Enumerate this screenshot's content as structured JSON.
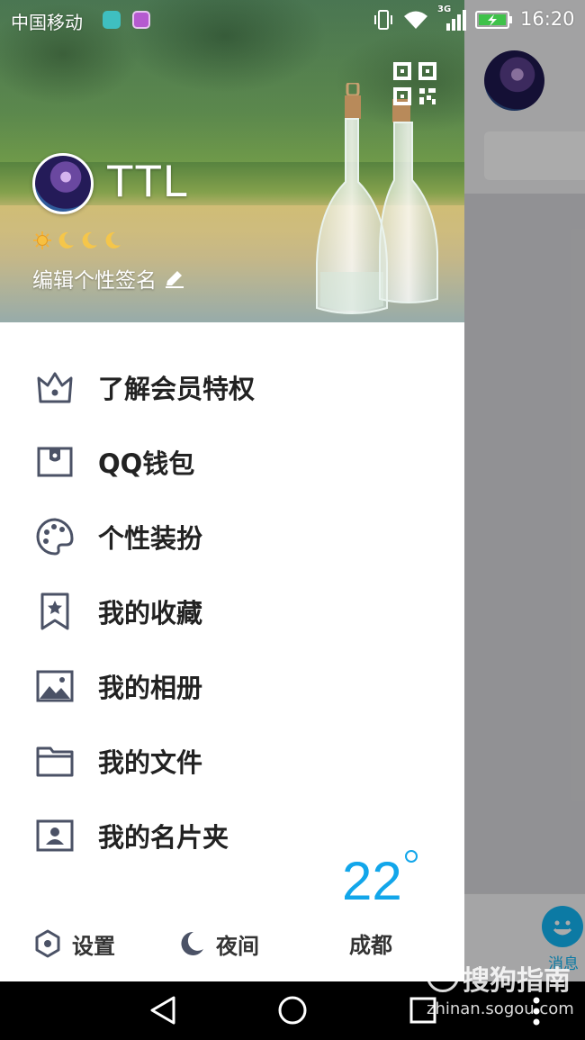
{
  "status_bar": {
    "carrier": "中国移动",
    "network": "3G",
    "time": "16:20",
    "icons": [
      "vibrate-icon",
      "wifi-icon",
      "signal-icon",
      "battery-charging-icon"
    ]
  },
  "profile": {
    "name": "TTL",
    "signature": "编辑个性签名",
    "level_icons": [
      "sun-icon",
      "moon-icon",
      "moon-icon",
      "moon-icon"
    ]
  },
  "menu": [
    {
      "label": "了解会员特权",
      "icon": "crown-icon"
    },
    {
      "label": "QQ钱包",
      "icon": "wallet-icon"
    },
    {
      "label": "个性装扮",
      "icon": "palette-icon"
    },
    {
      "label": "我的收藏",
      "icon": "bookmark-star-icon"
    },
    {
      "label": "我的相册",
      "icon": "photo-album-icon"
    },
    {
      "label": "我的文件",
      "icon": "folder-icon"
    },
    {
      "label": "我的名片夹",
      "icon": "contact-card-icon"
    }
  ],
  "weather": {
    "temperature": "22",
    "city": "成都"
  },
  "footer": {
    "settings_label": "设置",
    "night_label": "夜间"
  },
  "background_app": {
    "tab_label": "消息"
  },
  "watermark": {
    "brand": "搜狗指南",
    "url": "zhinan.sogou.com"
  },
  "colors": {
    "accent": "#12a6ea",
    "icon_gray": "#4b5266",
    "text_dark": "#222222"
  }
}
